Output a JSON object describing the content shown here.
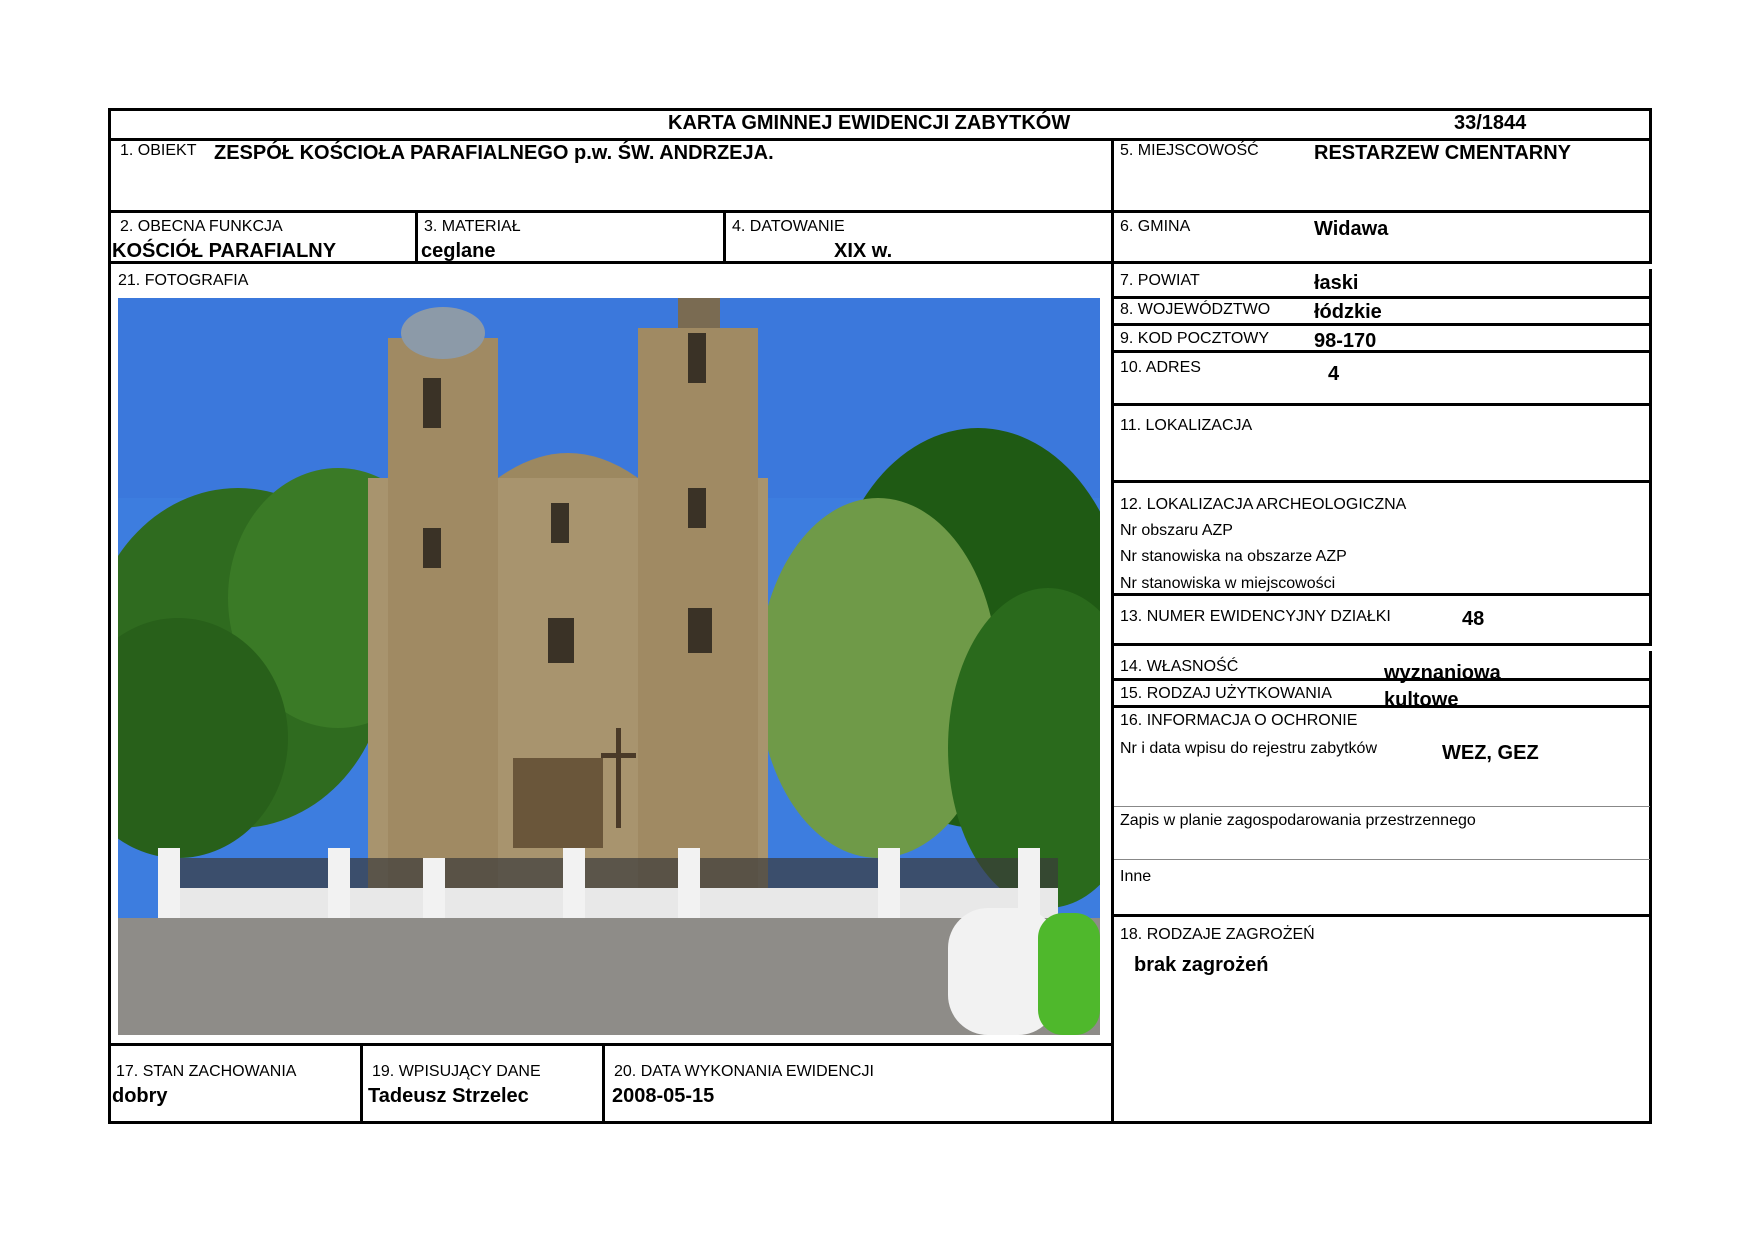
{
  "header": {
    "title": "KARTA GMINNEJ EWIDENCJI ZABYTKÓW",
    "number": "33/1844"
  },
  "f1": {
    "label": "1. OBIEKT",
    "value": "ZESPÓŁ  KOŚCIOŁA  PARAFIALNEGO  p.w.  ŚW.  ANDRZEJA."
  },
  "f2": {
    "label": "2. OBECNA FUNKCJA",
    "value": "KOŚCIÓŁ  PARAFIALNY"
  },
  "f3": {
    "label": "3. MATERIAŁ",
    "value": "ceglane"
  },
  "f4": {
    "label": "4. DATOWANIE",
    "value": "XIX  w."
  },
  "f5": {
    "label": "5. MIEJSCOWOŚĆ",
    "value": "RESTARZEW  CMENTARNY"
  },
  "f6": {
    "label": "6. GMINA",
    "value": "Widawa"
  },
  "f7": {
    "label": "7. POWIAT",
    "value": "łaski"
  },
  "f8": {
    "label": "8. WOJEWÓDZTWO",
    "value": "łódzkie"
  },
  "f9": {
    "label": "9. KOD POCZTOWY",
    "value": "98-170"
  },
  "f10": {
    "label": "10. ADRES",
    "value": "4"
  },
  "f11": {
    "label": "11. LOKALIZACJA"
  },
  "f12": {
    "label": "12. LOKALIZACJA ARCHEOLOGICZNA",
    "lines": [
      "Nr obszaru AZP",
      "Nr stanowiska na obszarze AZP",
      "Nr stanowiska w miejscowości"
    ]
  },
  "f13": {
    "label": "13. NUMER EWIDENCYJNY DZIAŁKI",
    "value": "48"
  },
  "f14": {
    "label": "14. WŁASNOŚĆ",
    "value": "wyznaniowa"
  },
  "f15": {
    "label": "15. RODZAJ UŻYTKOWANIA",
    "value": "kultowe"
  },
  "f16": {
    "label": "16. INFORMACJA O OCHRONIE",
    "register_label": "Nr i data wpisu do rejestru zabytków",
    "register_value": "WEZ,  GEZ",
    "plan_label": "Zapis w planie zagospodarowania przestrzennego",
    "other_label": "Inne"
  },
  "f17": {
    "label": "17. STAN ZACHOWANIA",
    "value": "dobry"
  },
  "f18": {
    "label": "18. RODZAJE ZAGROŻEŃ",
    "value": "brak zagrożeń"
  },
  "f19": {
    "label": "19. WPISUJĄCY DANE",
    "value": "Tadeusz Strzelec"
  },
  "f20": {
    "label": "20. DATA WYKONANIA EWIDENCJI",
    "value": "2008-05-15"
  },
  "f21": {
    "label": "21. FOTOGRAFIA"
  },
  "colors": {
    "border": "#000000",
    "sky": "#3d7ddf",
    "facade": "#a8946e",
    "foliage": "#2f6b1f"
  }
}
